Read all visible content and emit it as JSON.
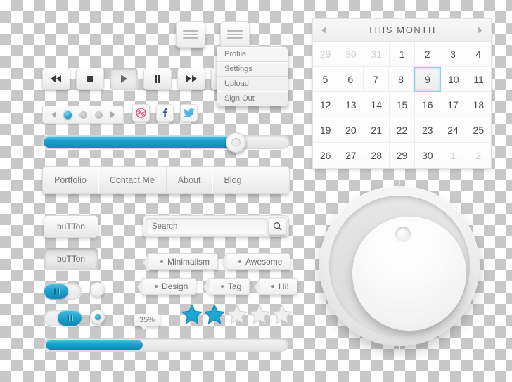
{
  "kit": {
    "title": "Light UI Kit",
    "accent_color": "#1fa1cb",
    "accent_dark": "#0e88b4",
    "surface_color": "#f2f2f2",
    "text_color": "#6f6f6f"
  },
  "media_player": {
    "buttons": [
      {
        "icon": "rewind-icon",
        "label": "Rewind",
        "state": "normal"
      },
      {
        "icon": "stop-icon",
        "label": "Stop",
        "state": "normal"
      },
      {
        "icon": "play-icon",
        "label": "Play",
        "state": "pressed"
      },
      {
        "icon": "pause-icon",
        "label": "Pause",
        "state": "normal"
      },
      {
        "icon": "fast-forward-icon",
        "label": "Fast Forward",
        "state": "normal"
      },
      {
        "icon": "mute-icon",
        "label": "Mute",
        "state": "normal"
      }
    ]
  },
  "carousel": {
    "prev_icon": "chevron-left-icon",
    "next_icon": "chevron-right-icon",
    "dots": 3,
    "active_dot": 1
  },
  "social": {
    "items": [
      {
        "icon": "dribbble-icon",
        "label": "Dribbble",
        "glyph": "◎",
        "color": "#ea4c89"
      },
      {
        "icon": "facebook-icon",
        "label": "Facebook",
        "glyph": "f",
        "color": "#3b5998"
      },
      {
        "icon": "twitter-icon",
        "label": "Twitter",
        "glyph": "✈",
        "color": "#4eb7e5"
      }
    ]
  },
  "menu": {
    "button_icon": "hamburger-icon",
    "button_label": "Menu",
    "items": [
      {
        "label": "Profile"
      },
      {
        "label": "Settings"
      },
      {
        "label": "Upload"
      },
      {
        "label": "Sign Out"
      }
    ]
  },
  "slider": {
    "value_percent": 77,
    "knob_label": "Slider handle"
  },
  "navbar": {
    "items": [
      {
        "label": "Portfolio"
      },
      {
        "label": "Contact Me"
      },
      {
        "label": "About"
      },
      {
        "label": "Blog"
      }
    ]
  },
  "buttons": {
    "normal_label": "buTTon",
    "active_label": "buTTon"
  },
  "search": {
    "value": "",
    "placeholder": "Search",
    "button_icon": "search-icon"
  },
  "tags": [
    {
      "label": "Minimalism"
    },
    {
      "label": "Awesome"
    },
    {
      "label": "Design"
    },
    {
      "label": "Tag"
    },
    {
      "label": "Hi!"
    }
  ],
  "toggles": [
    {
      "label": "Toggle off position",
      "state": "left"
    },
    {
      "label": "Toggle on position",
      "state": "right"
    }
  ],
  "radios": [
    {
      "label": "Radio unselected",
      "checked": false
    },
    {
      "label": "Radio selected",
      "checked": true
    }
  ],
  "tooltip": {
    "text": "35%"
  },
  "rating": {
    "total": 5,
    "filled": 2
  },
  "progress": {
    "value_percent": 40
  },
  "calendar": {
    "title": "THIS MONTH",
    "prev_icon": "triangle-left-icon",
    "next_icon": "triangle-right-icon",
    "selected_day": 9,
    "weeks": [
      [
        {
          "day": "29",
          "muted": true
        },
        {
          "day": "30",
          "muted": true
        },
        {
          "day": "31",
          "muted": true
        },
        {
          "day": "1",
          "muted": false
        },
        {
          "day": "2",
          "muted": false
        },
        {
          "day": "3",
          "muted": false
        },
        {
          "day": "4",
          "muted": false
        }
      ],
      [
        {
          "day": "5",
          "muted": false
        },
        {
          "day": "6",
          "muted": false
        },
        {
          "day": "7",
          "muted": false
        },
        {
          "day": "8",
          "muted": false
        },
        {
          "day": "9",
          "muted": false,
          "selected": true
        },
        {
          "day": "10",
          "muted": false
        },
        {
          "day": "11",
          "muted": false
        }
      ],
      [
        {
          "day": "12",
          "muted": false
        },
        {
          "day": "13",
          "muted": false
        },
        {
          "day": "14",
          "muted": false
        },
        {
          "day": "15",
          "muted": false
        },
        {
          "day": "16",
          "muted": false
        },
        {
          "day": "17",
          "muted": false
        },
        {
          "day": "18",
          "muted": false
        }
      ],
      [
        {
          "day": "19",
          "muted": false
        },
        {
          "day": "20",
          "muted": false
        },
        {
          "day": "21",
          "muted": false
        },
        {
          "day": "22",
          "muted": false
        },
        {
          "day": "23",
          "muted": false
        },
        {
          "day": "24",
          "muted": false
        },
        {
          "day": "25",
          "muted": false
        }
      ],
      [
        {
          "day": "26",
          "muted": false
        },
        {
          "day": "27",
          "muted": false
        },
        {
          "day": "28",
          "muted": false
        },
        {
          "day": "29",
          "muted": false
        },
        {
          "day": "30",
          "muted": false
        },
        {
          "day": "1",
          "muted": true
        },
        {
          "day": "2",
          "muted": true
        }
      ]
    ]
  },
  "knob": {
    "label": "Volume knob",
    "indicator_position": "top"
  }
}
